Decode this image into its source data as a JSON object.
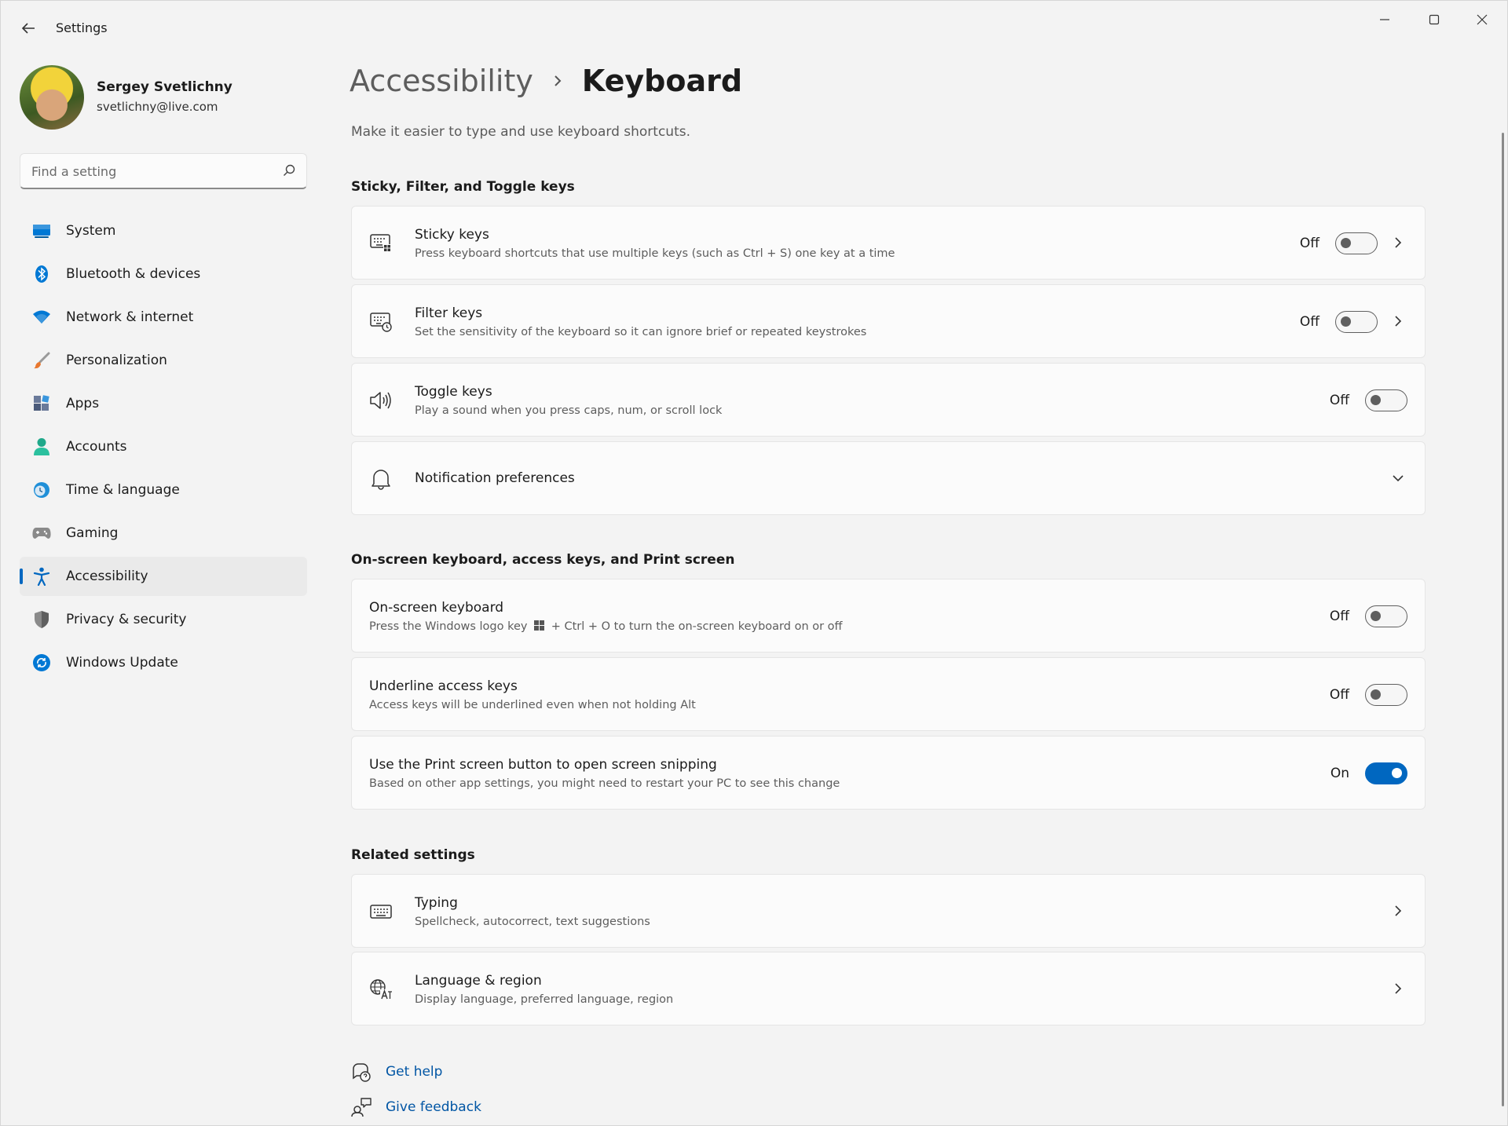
{
  "app": {
    "title": "Settings"
  },
  "profile": {
    "name": "Sergey Svetlichny",
    "email": "svetlichny@live.com"
  },
  "search": {
    "placeholder": "Find a setting"
  },
  "sidebar": {
    "items": [
      {
        "label": "System",
        "icon": "monitor-icon",
        "color": "#0078d4"
      },
      {
        "label": "Bluetooth & devices",
        "icon": "bluetooth-icon",
        "color": "#0078d4"
      },
      {
        "label": "Network & internet",
        "icon": "wifi-icon",
        "color": "#0078d4"
      },
      {
        "label": "Personalization",
        "icon": "brush-icon",
        "color": "#e8772e"
      },
      {
        "label": "Apps",
        "icon": "apps-icon",
        "color": "#4a5a7a"
      },
      {
        "label": "Accounts",
        "icon": "person-icon",
        "color": "#1fa88a"
      },
      {
        "label": "Time & language",
        "icon": "clock-globe-icon",
        "color": "#1f8fd8"
      },
      {
        "label": "Gaming",
        "icon": "gamepad-icon",
        "color": "#7a7a7a"
      },
      {
        "label": "Accessibility",
        "icon": "accessibility-icon",
        "color": "#0067c0",
        "active": true
      },
      {
        "label": "Privacy & security",
        "icon": "shield-icon",
        "color": "#6a6a6a"
      },
      {
        "label": "Windows Update",
        "icon": "update-icon",
        "color": "#0078d4"
      }
    ]
  },
  "breadcrumb": {
    "parent": "Accessibility",
    "current": "Keyboard"
  },
  "page": {
    "description": "Make it easier to type and use keyboard shortcuts."
  },
  "sections": {
    "sticky": {
      "title": "Sticky, Filter, and Toggle keys",
      "items": [
        {
          "title": "Sticky keys",
          "subtitle": "Press keyboard shortcuts that use multiple keys (such as Ctrl + S) one key at a time",
          "state": "Off",
          "icon": "sticky-keys-icon"
        },
        {
          "title": "Filter keys",
          "subtitle": "Set the sensitivity of the keyboard so it can ignore brief or repeated keystrokes",
          "state": "Off",
          "icon": "filter-keys-icon"
        },
        {
          "title": "Toggle keys",
          "subtitle": "Play a sound when you press caps, num, or scroll lock",
          "state": "Off",
          "icon": "speaker-icon"
        },
        {
          "title": "Notification preferences",
          "icon": "bell-icon"
        }
      ]
    },
    "onscreen": {
      "title": "On-screen keyboard, access keys, and Print screen",
      "items": [
        {
          "title": "On-screen keyboard",
          "subtitle_pre": "Press the Windows logo key",
          "subtitle_post": "+ Ctrl + O to turn the on-screen keyboard on or off",
          "state": "Off"
        },
        {
          "title": "Underline access keys",
          "subtitle": "Access keys will be underlined even when not holding Alt",
          "state": "Off"
        },
        {
          "title": "Use the Print screen button to open screen snipping",
          "subtitle": "Based on other app settings, you might need to restart your PC to see this change",
          "state": "On"
        }
      ]
    },
    "related": {
      "title": "Related settings",
      "items": [
        {
          "title": "Typing",
          "subtitle": "Spellcheck, autocorrect, text suggestions",
          "icon": "keyboard-icon"
        },
        {
          "title": "Language & region",
          "subtitle": "Display language, preferred language, region",
          "icon": "language-icon"
        }
      ]
    }
  },
  "help": {
    "get_help": "Get help",
    "give_feedback": "Give feedback"
  },
  "colors": {
    "accent": "#0067c0",
    "link": "#0055a4"
  }
}
